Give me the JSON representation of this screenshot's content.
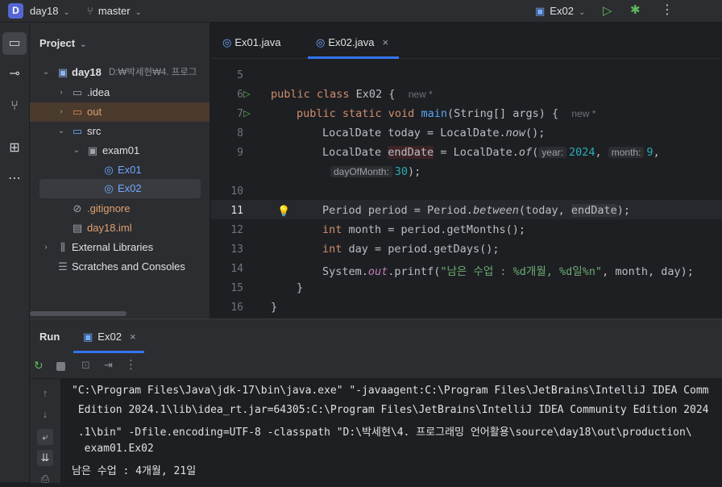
{
  "titlebar": {
    "project_initial": "D",
    "project_name": "day18",
    "branch": "master",
    "run_config": "Ex02"
  },
  "project_panel": {
    "title": "Project",
    "tree": [
      {
        "label": "day18",
        "path": "D:₩박세현₩4. 프로그"
      },
      {
        "label": ".idea"
      },
      {
        "label": "out"
      },
      {
        "label": "src"
      },
      {
        "label": "exam01"
      },
      {
        "label": "Ex01"
      },
      {
        "label": "Ex02"
      },
      {
        "label": ".gitignore"
      },
      {
        "label": "day18.iml"
      },
      {
        "label": "External Libraries"
      },
      {
        "label": "Scratches and Consoles"
      }
    ]
  },
  "editor": {
    "tabs": [
      {
        "label": "Ex01.java"
      },
      {
        "label": "Ex02.java",
        "close": "×"
      }
    ],
    "line_numbers": [
      "5",
      "6",
      "7",
      "8",
      "9",
      "",
      "10",
      "11",
      "12",
      "13",
      "14",
      "15",
      "16"
    ],
    "code": {
      "l6_kw": "public class ",
      "l6_name": "Ex02 {",
      "l6_hint": "new *",
      "l7_kw": "public static void ",
      "l7_fn": "main",
      "l7_rest": "(String[] args) {",
      "l7_hint": "new *",
      "l8_a": "LocalDate today = LocalDate.",
      "l8_m": "now",
      "l8_b": "();",
      "l9_a": "LocalDate ",
      "l9_v": "endDate",
      "l9_b": " = LocalDate.",
      "l9_m": "of",
      "l9_c": "(",
      "l9_h1": "year:",
      "l9_n1": "2024",
      "l9_s1": ", ",
      "l9_h2": "month:",
      "l9_n2": "9",
      "l9_s2": ",",
      "l9b_h": "dayOfMonth:",
      "l9b_n": "30",
      "l9b_e": ");",
      "l11_a": "Period period = Period.",
      "l11_m": "between",
      "l11_b": "(today, ",
      "l11_v": "endDate",
      "l11_c": ");",
      "l12_kw": "int ",
      "l12_rest": "month = period.getMonths();",
      "l13_kw": "int ",
      "l13_rest": "day = period.getDays();",
      "l14_a": "System.",
      "l14_out": "out",
      "l14_b": ".printf(",
      "l14_str": "\"남은 수업 : %d개월, %d일%n\"",
      "l14_c": ", month, day);",
      "l15": "}",
      "l16": "}"
    }
  },
  "run_panel": {
    "title": "Run",
    "tab_label": "Ex02",
    "tab_close": "×",
    "console": [
      "\"C:\\Program Files\\Java\\jdk-17\\bin\\java.exe\" \"-javaagent:C:\\Program Files\\JetBrains\\IntelliJ IDEA Comm",
      " Edition 2024.1\\lib\\idea_rt.jar=64305:C:\\Program Files\\JetBrains\\IntelliJ IDEA Community Edition 2024",
      " .1\\bin\" -Dfile.encoding=UTF-8 -classpath \"D:\\박세현\\4. 프로그래밍 언어활용\\source\\day18\\out\\production\\",
      "  exam01.Ex02",
      "남은 수업 : 4개월, 21일"
    ]
  },
  "colors": {
    "accent": "#3574f0",
    "run_green": "#5fb85f"
  }
}
